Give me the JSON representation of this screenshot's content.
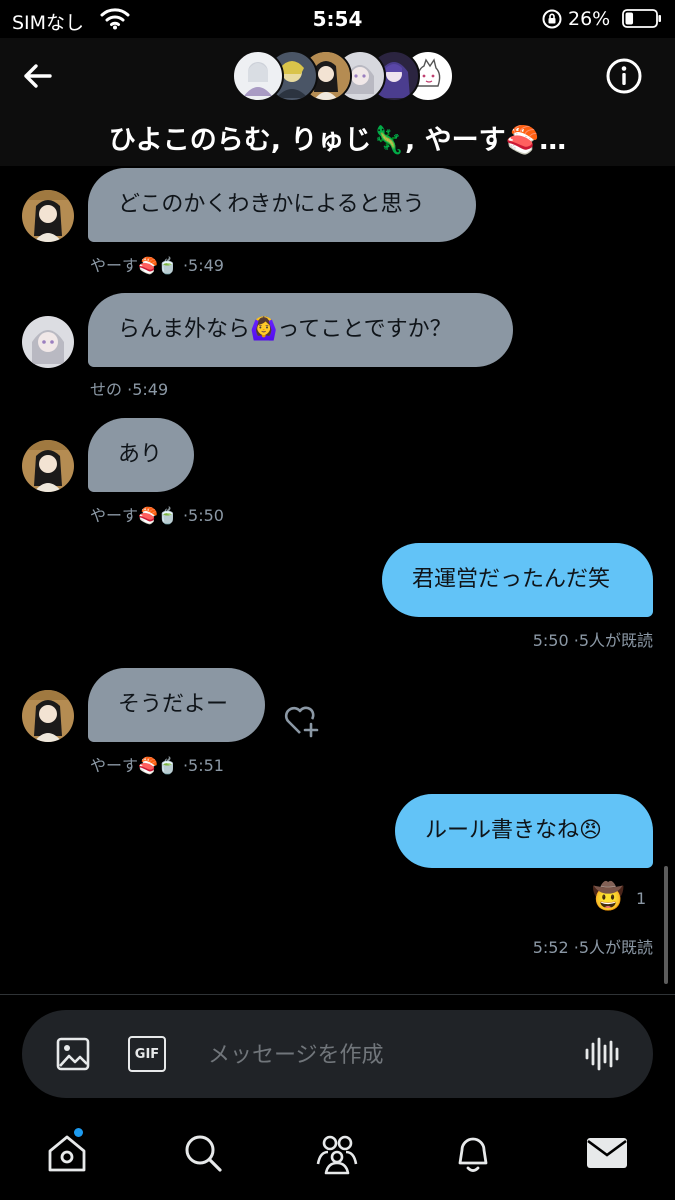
{
  "status_bar": {
    "carrier": "SIMなし",
    "time": "5:54",
    "battery_percent": "26%",
    "battery_level": 0.26
  },
  "header": {
    "group_title": "ひよこのらむ, りゅじ🦎, やーす🍣…",
    "participant_avatars": 6,
    "icons": {
      "back": "back-arrow-icon",
      "info": "info-icon"
    }
  },
  "messages": [
    {
      "direction": "in",
      "sender": "やーす🍣🍵",
      "text": "どこのかくわきかによると思う",
      "time": "5:49"
    },
    {
      "direction": "in",
      "sender": "せの",
      "text": "らんま外なら🙆‍♀️ってことですか？",
      "time": "5:49"
    },
    {
      "direction": "in",
      "sender": "やーす🍣🍵",
      "text": "あり",
      "time": "5:50"
    },
    {
      "direction": "out",
      "text": "君運営だったんだ笑",
      "time": "5:50",
      "read": "5人が既読"
    },
    {
      "direction": "in",
      "sender": "やーす🍣🍵",
      "text": "そうだよー",
      "time": "5:51"
    },
    {
      "direction": "out",
      "text": "ルール書きなね😠",
      "time": "5:52",
      "read": "5人が既読",
      "reaction": {
        "emoji": "🤠",
        "count": "1"
      }
    }
  ],
  "composer": {
    "placeholder": "メッセージを作成",
    "gif_label": "GIF",
    "icons": {
      "image": "image-icon",
      "gif": "gif-icon",
      "voice": "voice-wave-icon"
    }
  },
  "tabbar": {
    "items": [
      "home-icon",
      "search-icon",
      "communities-icon",
      "notifications-icon",
      "messages-icon"
    ]
  },
  "colors": {
    "incoming_bubble": "#8b97a3",
    "outgoing_bubble": "#62c3f7",
    "meta_text": "#8b98a5",
    "accent": "#1d9bf0"
  }
}
